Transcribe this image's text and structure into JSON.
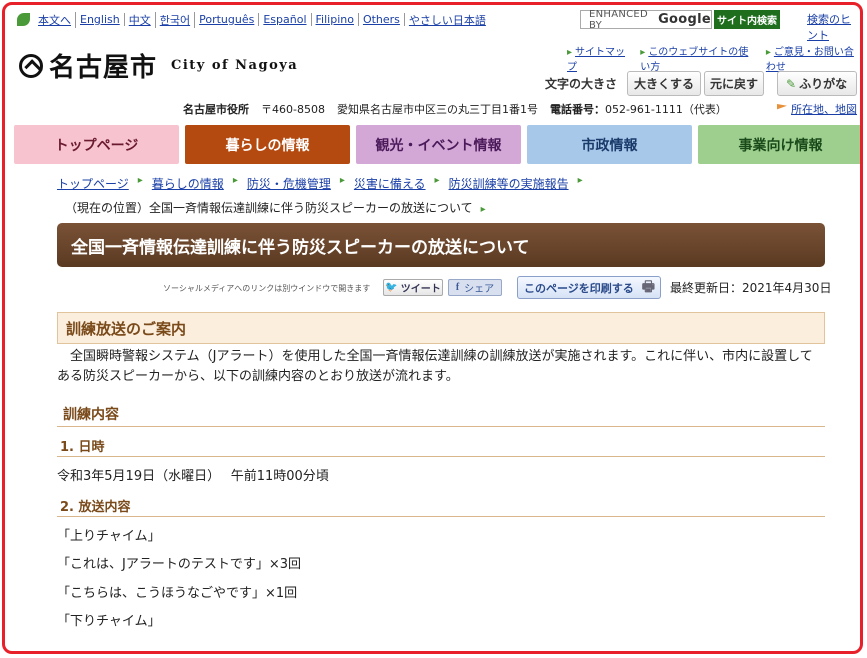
{
  "lang_bar": [
    "本文へ",
    "English",
    "中文",
    "한국어",
    "Português",
    "Español",
    "Filipino",
    "Others",
    "やさしい日本語"
  ],
  "search": {
    "placeholder_prefix": "ENHANCED BY",
    "placeholder_brand": "Google",
    "button": "サイト内検索",
    "help": "検索のヒント"
  },
  "logo": {
    "jp": "名古屋市",
    "en": "City of Nagoya"
  },
  "top_links": [
    "サイトマップ",
    "このウェブサイトの使い方",
    "ご意見・お問い合わせ"
  ],
  "font_size": {
    "label": "文字の大きさ",
    "enlarge": "大きくする",
    "reset": "元に戻す",
    "furigana": "ふりがな"
  },
  "address": {
    "office": "名古屋市役所",
    "zip": "〒460-8508",
    "addr": "愛知県名古屋市中区三の丸三丁目1番1号",
    "phone_label": "電話番号：",
    "phone": "052-961-1111（代表）",
    "access": "所在地、地図"
  },
  "nav": [
    {
      "label": "トップページ",
      "bg": "#f7c3cf",
      "color": "#6a1a2e"
    },
    {
      "label": "暮らしの情報",
      "bg": "#b54a10",
      "color": "#ffffff"
    },
    {
      "label": "観光・イベント情報",
      "bg": "#d4a8d6",
      "color": "#4a1a5a"
    },
    {
      "label": "市政情報",
      "bg": "#a8c8ea",
      "color": "#1a3a6a"
    },
    {
      "label": "事業向け情報",
      "bg": "#9ecf8e",
      "color": "#1a4a1a"
    }
  ],
  "breadcrumb": [
    "トップページ",
    "暮らしの情報",
    "防災・危機管理",
    "災害に備える",
    "防災訓練等の実施報告"
  ],
  "current_location": "（現在の位置）全国一斉情報伝達訓練に伴う防災スピーカーの放送について",
  "page_title": "全国一斉情報伝達訓練に伴う防災スピーカーの放送について",
  "social": {
    "note": "ソーシャルメディアへのリンクは別ウインドウで開きます",
    "tweet": "ツイート",
    "share": "シェア",
    "print": "このページを印刷する",
    "updated": "最終更新日：2021年4月30日"
  },
  "content": {
    "h2": "訓練放送のご案内",
    "paragraph": "全国瞬時警報システム（Jアラート）を使用した全国一斉情報伝達訓練の訓練放送が実施されます。これに伴い、市内に設置してある防災スピーカーから、以下の訓練内容のとおり放送が流れます。",
    "h3": "訓練内容",
    "sec1_title": "1. 日時",
    "sec1_text": "令和3年5月19日（水曜日）　 午前11時00分頃",
    "sec2_title": "2. 放送内容",
    "broadcast_lines": [
      "「上りチャイム」",
      "「これは、Jアラートのテストです」×3回",
      "「こちらは、こうほうなごやです」×1回",
      "「下りチャイム」"
    ]
  }
}
